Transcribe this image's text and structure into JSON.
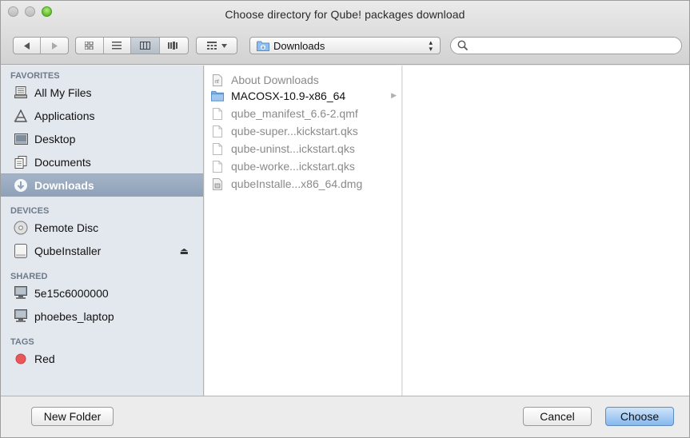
{
  "window": {
    "title": "Choose directory for Qube! packages download"
  },
  "toolbar": {
    "path_popup_label": "Downloads",
    "search_placeholder": "",
    "icons": {
      "back": "back-arrow-icon",
      "forward": "forward-arrow-icon",
      "icon_view": "icon-view-icon",
      "list_view": "list-view-icon",
      "column_view": "column-view-icon",
      "coverflow_view": "cover-flow-icon",
      "arrange": "arrange-menu-icon",
      "search": "search-icon"
    },
    "active_view": "column"
  },
  "sidebar": {
    "sections": [
      {
        "label": "FAVORITES",
        "items": [
          {
            "label": "All My Files",
            "icon": "all-files-icon"
          },
          {
            "label": "Applications",
            "icon": "applications-icon"
          },
          {
            "label": "Desktop",
            "icon": "desktop-icon"
          },
          {
            "label": "Documents",
            "icon": "documents-icon"
          },
          {
            "label": "Downloads",
            "icon": "downloads-icon",
            "selected": true
          }
        ]
      },
      {
        "label": "DEVICES",
        "items": [
          {
            "label": "Remote Disc",
            "icon": "disc-icon"
          },
          {
            "label": "QubeInstaller",
            "icon": "disk-image-icon",
            "eject": true
          }
        ]
      },
      {
        "label": "SHARED",
        "items": [
          {
            "label": "5e15c6000000",
            "icon": "computer-icon"
          },
          {
            "label": "phoebes_laptop",
            "icon": "computer-icon"
          }
        ]
      },
      {
        "label": "TAGS",
        "items": [
          {
            "label": "Red",
            "icon": "tag-dot-icon",
            "color": "#e8585a"
          }
        ]
      }
    ]
  },
  "files": [
    {
      "name": "About Downloads",
      "kind": "document"
    },
    {
      "name": "MACOSX-10.9-x86_64",
      "kind": "folder"
    },
    {
      "name": "qube_manifest_6.6-2.qmf",
      "kind": "file"
    },
    {
      "name": "qube-super...kickstart.qks",
      "kind": "file"
    },
    {
      "name": "qube-uninst...ickstart.qks",
      "kind": "file"
    },
    {
      "name": "qube-worke...ickstart.qks",
      "kind": "file"
    },
    {
      "name": "qubeInstalle...x86_64.dmg",
      "kind": "dmg"
    }
  ],
  "footer": {
    "new_folder_label": "New Folder",
    "cancel_label": "Cancel",
    "choose_label": "Choose"
  },
  "colors": {
    "selection": "#9aaac0",
    "sidebar_bg": "#e3e8ee",
    "primary_button": "#87b8ec",
    "folder": "#7fb2e5",
    "tag_red": "#e8585a"
  }
}
